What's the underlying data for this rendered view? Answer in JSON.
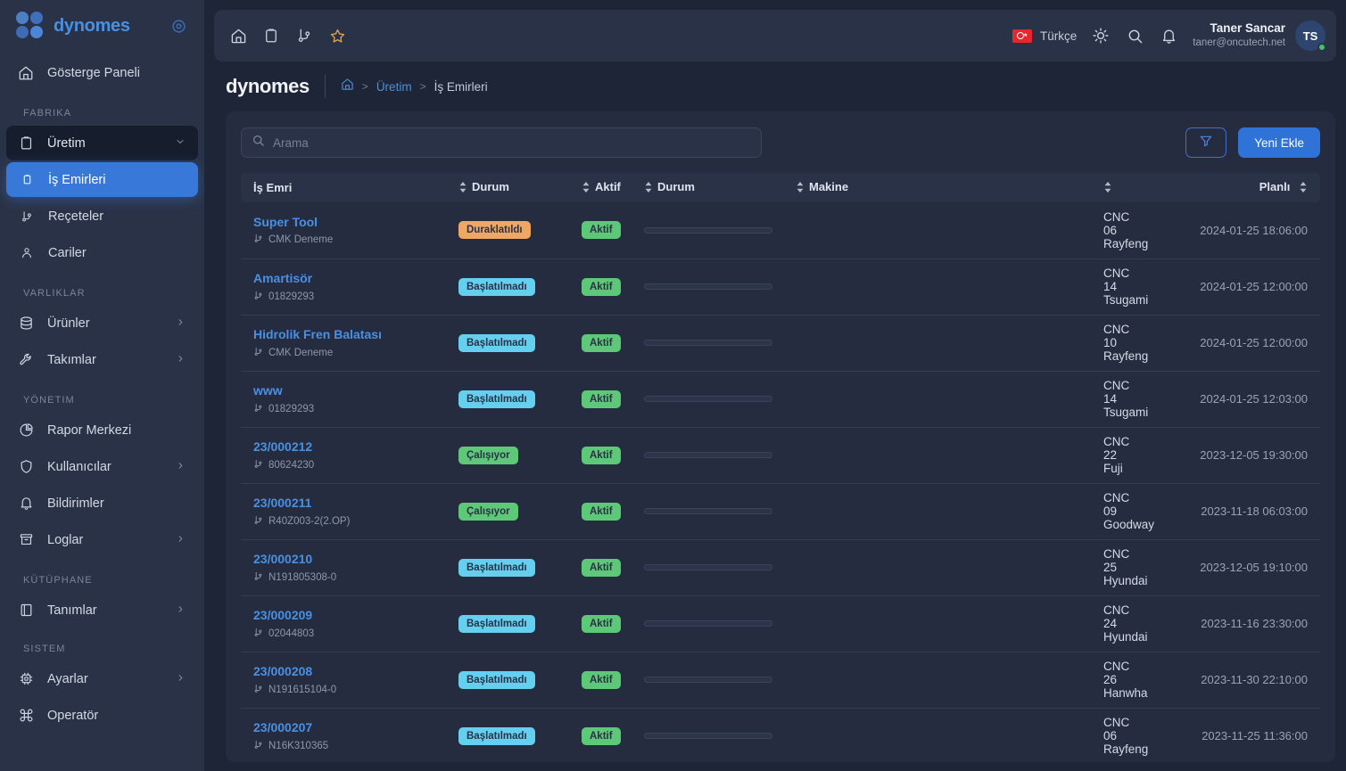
{
  "brand": {
    "name": "dynomes",
    "collapse_icon": "target-icon"
  },
  "sidebar": {
    "dashboard": {
      "label": "Gösterge Paneli",
      "icon": "home-icon"
    },
    "sections": [
      {
        "title": "FABRIKA"
      },
      {
        "title": "VARLIKLAR"
      },
      {
        "title": "YÖNETIM"
      },
      {
        "title": "KÜTÜPHANE"
      },
      {
        "title": "SISTEM"
      }
    ],
    "items": [
      {
        "label": "Üretim",
        "icon": "clipboard-icon",
        "state": "expanded",
        "chevron": "chevron-down-icon"
      },
      {
        "label": "İş Emirleri",
        "icon": "clipboard-small-icon",
        "state": "active"
      },
      {
        "label": "Reçeteler",
        "icon": "git-branch-icon",
        "state": "normal"
      },
      {
        "label": "Cariler",
        "icon": "user-icon",
        "state": "normal"
      },
      {
        "label": "Ürünler",
        "icon": "database-icon",
        "state": "normal",
        "chevron": "chevron-right-icon"
      },
      {
        "label": "Takımlar",
        "icon": "wrench-icon",
        "state": "normal",
        "chevron": "chevron-right-icon"
      },
      {
        "label": "Rapor Merkezi",
        "icon": "pie-chart-icon",
        "state": "normal"
      },
      {
        "label": "Kullanıcılar",
        "icon": "shield-icon",
        "state": "normal",
        "chevron": "chevron-right-icon"
      },
      {
        "label": "Bildirimler",
        "icon": "bell-icon",
        "state": "normal"
      },
      {
        "label": "Loglar",
        "icon": "archive-icon",
        "state": "normal",
        "chevron": "chevron-right-icon"
      },
      {
        "label": "Tanımlar",
        "icon": "book-icon",
        "state": "normal",
        "chevron": "chevron-right-icon"
      },
      {
        "label": "Ayarlar",
        "icon": "cpu-icon",
        "state": "normal",
        "chevron": "chevron-right-icon"
      },
      {
        "label": "Operatör",
        "icon": "command-icon",
        "state": "normal"
      }
    ]
  },
  "topbar": {
    "icons": [
      "home-icon",
      "clipboard-icon",
      "git-branch-icon",
      "star-icon"
    ],
    "language": {
      "label": "Türkçe",
      "flag": "tr-flag-icon"
    },
    "theme_icon": "sun-icon",
    "search_icon": "search-icon",
    "bell_icon": "bell-icon",
    "user": {
      "name": "Taner Sancar",
      "email": "taner@oncutech.net",
      "initials": "TS",
      "status": "online"
    }
  },
  "breadcrumb": {
    "brand": "dynomes",
    "home_icon": "home-icon",
    "parent": "Üretim",
    "current": "İş Emirleri"
  },
  "toolbar": {
    "search_placeholder": "Arama",
    "search_value": "",
    "search_icon": "search-icon",
    "filter_icon": "filter-icon",
    "add_label": "Yeni Ekle"
  },
  "table": {
    "columns": [
      {
        "label": "İş Emri",
        "sort": false,
        "align": "left"
      },
      {
        "label": "Durum",
        "sort": true,
        "align": "left"
      },
      {
        "label": "Aktif",
        "sort": true,
        "align": "left"
      },
      {
        "label": "Durum",
        "sort": true,
        "align": "left"
      },
      {
        "label": "Makine",
        "sort": true,
        "align": "left"
      },
      {
        "label": "",
        "sort": true,
        "align": "left"
      },
      {
        "label": "Planlı",
        "sort": true,
        "align": "right"
      }
    ],
    "rows": [
      {
        "name": "Super Tool",
        "code": "CMK Deneme",
        "status": "Duraklatıldı",
        "status_kind": "paused",
        "active": "Aktif",
        "progress": 0,
        "machine": "CNC 06 Rayfeng",
        "planned": "2024-01-25 18:06:00"
      },
      {
        "name": "Amartisör",
        "code": "01829293",
        "status": "Başlatılmadı",
        "status_kind": "notstarted",
        "active": "Aktif",
        "progress": 0,
        "machine": "CNC 14 Tsugami",
        "planned": "2024-01-25 12:00:00"
      },
      {
        "name": "Hidrolik Fren Balatası",
        "code": "CMK Deneme",
        "status": "Başlatılmadı",
        "status_kind": "notstarted",
        "active": "Aktif",
        "progress": 0,
        "machine": "CNC 10 Rayfeng",
        "planned": "2024-01-25 12:00:00"
      },
      {
        "name": "www",
        "code": "01829293",
        "status": "Başlatılmadı",
        "status_kind": "notstarted",
        "active": "Aktif",
        "progress": 0,
        "machine": "CNC 14 Tsugami",
        "planned": "2024-01-25 12:03:00"
      },
      {
        "name": "23/000212",
        "code": "80624230",
        "status": "Çalışıyor",
        "status_kind": "running",
        "active": "Aktif",
        "progress": 0,
        "machine": "CNC 22 Fuji",
        "planned": "2023-12-05 19:30:00"
      },
      {
        "name": "23/000211",
        "code": "R40Z003-2(2.OP)",
        "status": "Çalışıyor",
        "status_kind": "running",
        "active": "Aktif",
        "progress": 0,
        "machine": "CNC 09 Goodway",
        "planned": "2023-11-18 06:03:00"
      },
      {
        "name": "23/000210",
        "code": "N191805308-0",
        "status": "Başlatılmadı",
        "status_kind": "notstarted",
        "active": "Aktif",
        "progress": 0,
        "machine": "CNC 25 Hyundai",
        "planned": "2023-12-05 19:10:00"
      },
      {
        "name": "23/000209",
        "code": "02044803",
        "status": "Başlatılmadı",
        "status_kind": "notstarted",
        "active": "Aktif",
        "progress": 0,
        "machine": "CNC 24 Hyundai",
        "planned": "2023-11-16 23:30:00"
      },
      {
        "name": "23/000208",
        "code": "N191615104-0",
        "status": "Başlatılmadı",
        "status_kind": "notstarted",
        "active": "Aktif",
        "progress": 0,
        "machine": "CNC 26 Hanwha",
        "planned": "2023-11-30 22:10:00"
      },
      {
        "name": "23/000207",
        "code": "N16K310365",
        "status": "Başlatılmadı",
        "status_kind": "notstarted",
        "active": "Aktif",
        "progress": 0,
        "machine": "CNC 06 Rayfeng",
        "planned": "2023-11-25 11:36:00"
      }
    ]
  },
  "colors": {
    "accent": "#3878d8",
    "link": "#4a90e2",
    "sidebar_bg": "#2a3247",
    "page_bg": "#1e2536",
    "panel_bg": "#252c40",
    "badge_paused": "#efa864",
    "badge_notstarted": "#64cfee",
    "badge_running": "#5cc878",
    "badge_active": "#5cc878",
    "online": "#3fc45f"
  }
}
